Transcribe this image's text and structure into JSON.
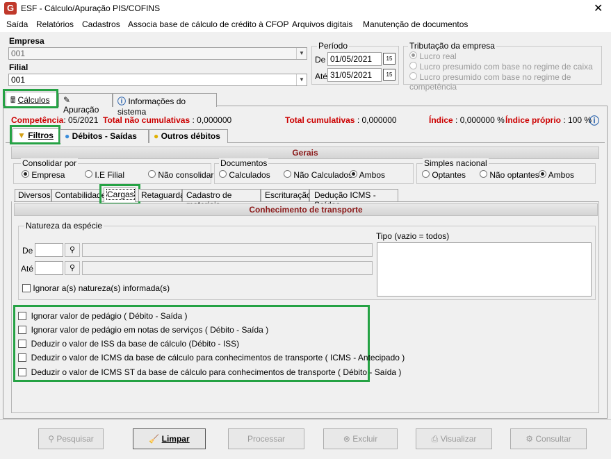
{
  "window": {
    "title": "ESF - Cálculo/Apuração PIS/COFINS",
    "logo": "G",
    "close": "✕"
  },
  "menu": [
    "Saída",
    "Relatórios",
    "Cadastros",
    "Associa base de cálculo de crédito à CFOP",
    "Arquivos digitais",
    "Manutenção de documentos"
  ],
  "empresa": {
    "label": "Empresa",
    "value": "001"
  },
  "filial": {
    "label": "Filial",
    "value": "001"
  },
  "periodo": {
    "title": "Período",
    "de_label": "De",
    "de_value": "01/05/2021",
    "ate_label": "Até",
    "ate_value": "31/05/2021",
    "cal_icon": "15"
  },
  "tributacao": {
    "title": "Tributação da empresa",
    "options": [
      "Lucro real",
      "Lucro presumido com base no regime de caixa",
      "Lucro presumido com base no regime de competência"
    ],
    "selected": 0
  },
  "main_tabs": [
    "Cálculos",
    "Apuração",
    "Informações do sistema"
  ],
  "status": {
    "competencia_label": "Competência",
    "competencia_value": ": 05/2021",
    "tnc_label": "Total não cumulativas",
    "tnc_value": ": 0,000000",
    "tc_label": "Total cumulativas",
    "tc_value": ": 0,000000",
    "indice_label": "Índice",
    "indice_value": ": 0,000000 %",
    "indice_proprio_label": "Índice próprio",
    "indice_proprio_value": ": 100 %"
  },
  "sub_tabs": [
    "Filtros",
    "Débitos - Saídas",
    "Outros débitos"
  ],
  "gerais": {
    "header": "Gerais",
    "consolidar": {
      "title": "Consolidar por",
      "options": [
        "Empresa",
        "I.E Filial",
        "Não consolidar"
      ],
      "selected": 0
    },
    "documentos": {
      "title": "Documentos",
      "options": [
        "Calculados",
        "Não Calculados",
        "Ambos"
      ],
      "selected": 2
    },
    "simples": {
      "title": "Simples nacional",
      "options": [
        "Optantes",
        "Não optantes",
        "Ambos"
      ],
      "selected": 2
    }
  },
  "inner_tabs": [
    "Diversos",
    "Contabilidade",
    "Cargas",
    "Retaguarda",
    "Cadastro de materiais",
    "Escrituração",
    "Dedução ICMS - Saídas"
  ],
  "conhecimento": {
    "header": "Conhecimento de transporte",
    "natureza_title": "Natureza da espécie",
    "de_label": "De",
    "ate_label": "Até",
    "ignorar_label": "Ignorar a(s) natureza(s) informada(s)",
    "tipo_label": "Tipo (vazio = todos)"
  },
  "checks": [
    "Ignorar valor de pedágio ( Débito - Saída )",
    "Ignorar valor de pedágio em notas de serviços ( Débito - Saída )",
    "Deduzir o valor de ISS da base de cálculo (Débito - ISS)",
    "Deduzir o valor de ICMS da base de cálculo para conhecimentos de transporte ( ICMS - Antecipado )",
    "Deduzir o valor de ICMS ST da base de cálculo para conhecimentos de transporte ( Débito - Saída )"
  ],
  "buttons": {
    "pesquisar": "Pesquisar",
    "limpar": "Limpar",
    "processar": "Processar",
    "excluir": "Excluir",
    "visualizar": "Visualizar",
    "consultar": "Consultar"
  },
  "colors": {
    "accent_green": "#25a244",
    "red": "#cc0000",
    "header_text": "#8b1a1a"
  }
}
